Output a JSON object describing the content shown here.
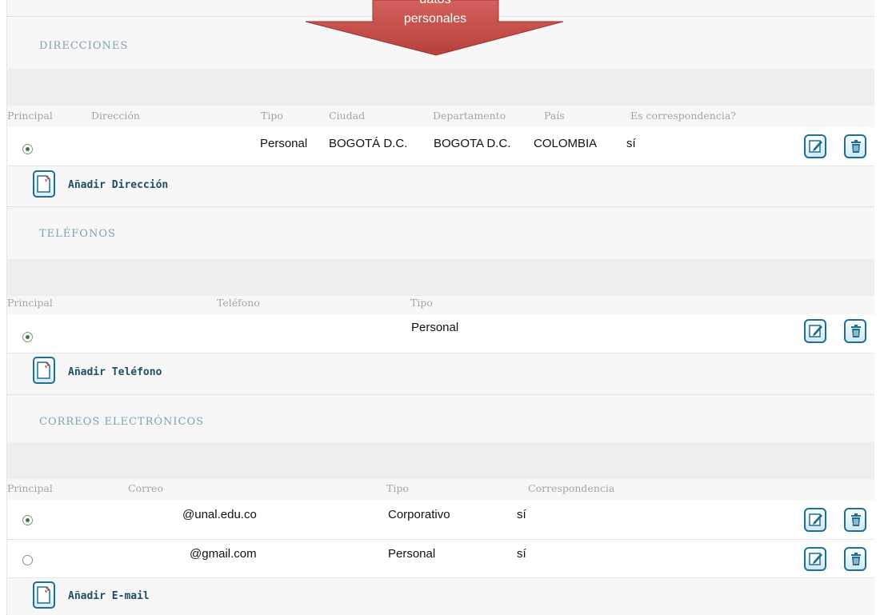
{
  "arrow": {
    "line1": "datos",
    "line2": "personales"
  },
  "direcciones": {
    "title": "DIRECCIONES",
    "headers": {
      "principal": "Principal",
      "direccion": "Dirección",
      "tipo": "Tipo",
      "ciudad": "Ciudad",
      "departamento": "Departamento",
      "pais": "País",
      "correspondencia": "Es correspondencia?"
    },
    "rows": [
      {
        "tipo": "Personal",
        "ciudad": "BOGOTÁ D.C.",
        "departamento": "BOGOTA D.C.",
        "pais": "COLOMBIA",
        "correspondencia": "sí",
        "principal": true
      }
    ],
    "add_label": "Añadir Dirección"
  },
  "telefonos": {
    "title": "TELÉFONOS",
    "headers": {
      "principal": "Principal",
      "telefono": "Teléfono",
      "tipo": "Tipo"
    },
    "rows": [
      {
        "tipo": "Personal",
        "principal": true
      }
    ],
    "add_label": "Añadir Teléfono"
  },
  "correos": {
    "title": "CORREOS ELECTRÓNICOS",
    "headers": {
      "principal": "Principal",
      "correo": "Correo",
      "tipo": "Tipo",
      "correspondencia": "Correspondencia"
    },
    "rows": [
      {
        "correo": "@unal.edu.co",
        "tipo": "Corporativo",
        "correspondencia": "sí",
        "principal": true
      },
      {
        "correo": "@gmail.com",
        "tipo": "Personal",
        "correspondencia": "sí",
        "principal": false
      }
    ],
    "add_label": "Añadir E-mail"
  },
  "colors": {
    "arrow": "#c0504d",
    "title": "#7fa2b4",
    "button_border": "#1e6f97",
    "link": "#1e4e66"
  }
}
